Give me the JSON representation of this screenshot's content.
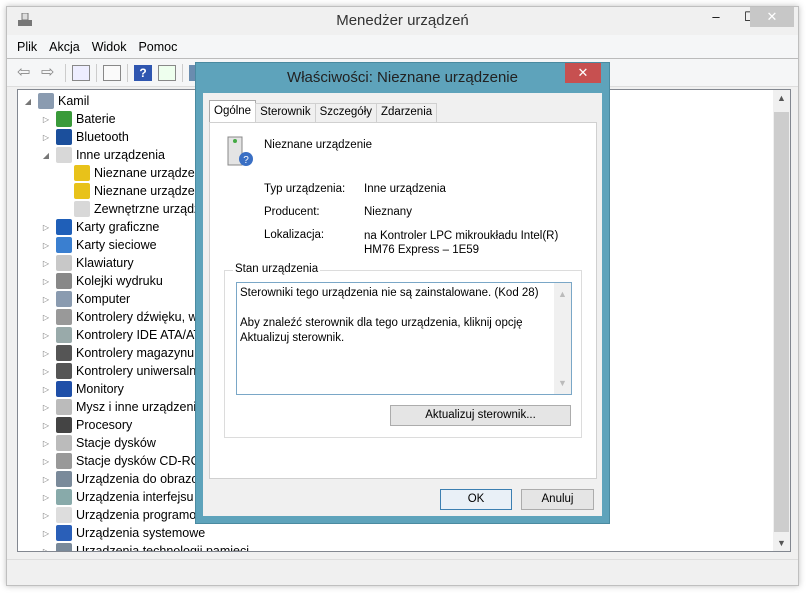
{
  "window": {
    "title": "Menedżer urządzeń",
    "minimize": "–",
    "maximize": "☐",
    "close": "✕"
  },
  "menu": [
    "Plik",
    "Akcja",
    "Widok",
    "Pomoc"
  ],
  "toolbar_icons": [
    "back-icon",
    "forward-icon",
    "properties-pane-icon",
    "console-icon",
    "help-icon",
    "action-pane-icon",
    "scan-hardware-icon"
  ],
  "tree": [
    {
      "label": "Kamil",
      "level": 0,
      "expanded": true,
      "icon": "computer-icon"
    },
    {
      "label": "Baterie",
      "level": 1,
      "expanded": false,
      "icon": "battery-icon"
    },
    {
      "label": "Bluetooth",
      "level": 1,
      "expanded": false,
      "icon": "bluetooth-icon"
    },
    {
      "label": "Inne urządzenia",
      "level": 1,
      "expanded": true,
      "icon": "unknown-device-icon"
    },
    {
      "label": "Nieznane urządzen",
      "level": 2,
      "icon": "warning-device-icon"
    },
    {
      "label": "Nieznane urządzen",
      "level": 2,
      "icon": "warning-device-icon"
    },
    {
      "label": "Zewnętrzne urządz",
      "level": 2,
      "icon": "unknown-device-icon"
    },
    {
      "label": "Karty graficzne",
      "level": 1,
      "expanded": false,
      "icon": "display-adapter-icon"
    },
    {
      "label": "Karty sieciowe",
      "level": 1,
      "expanded": false,
      "icon": "network-adapter-icon"
    },
    {
      "label": "Klawiatury",
      "level": 1,
      "expanded": false,
      "icon": "keyboard-icon"
    },
    {
      "label": "Kolejki wydruku",
      "level": 1,
      "expanded": false,
      "icon": "printer-icon"
    },
    {
      "label": "Komputer",
      "level": 1,
      "expanded": false,
      "icon": "computer-icon"
    },
    {
      "label": "Kontrolery dźwięku, wi",
      "level": 1,
      "expanded": false,
      "icon": "speaker-icon"
    },
    {
      "label": "Kontrolery IDE ATA/AT",
      "level": 1,
      "expanded": false,
      "icon": "ide-icon"
    },
    {
      "label": "Kontrolery magazynu",
      "level": 1,
      "expanded": false,
      "icon": "storage-icon"
    },
    {
      "label": "Kontrolery uniwersalne",
      "level": 1,
      "expanded": false,
      "icon": "usb-icon"
    },
    {
      "label": "Monitory",
      "level": 1,
      "expanded": false,
      "icon": "monitor-icon"
    },
    {
      "label": "Mysz i inne urządzenia",
      "level": 1,
      "expanded": false,
      "icon": "mouse-icon"
    },
    {
      "label": "Procesory",
      "level": 1,
      "expanded": false,
      "icon": "processor-icon"
    },
    {
      "label": "Stacje dysków",
      "level": 1,
      "expanded": false,
      "icon": "disk-icon"
    },
    {
      "label": "Stacje dysków CD-ROM",
      "level": 1,
      "expanded": false,
      "icon": "cdrom-icon"
    },
    {
      "label": "Urządzenia do obrazow",
      "level": 1,
      "expanded": false,
      "icon": "camera-icon"
    },
    {
      "label": "Urządzenia interfejsu H",
      "level": 1,
      "expanded": false,
      "icon": "hid-icon"
    },
    {
      "label": "Urządzenia programow",
      "level": 1,
      "expanded": false,
      "icon": "software-device-icon"
    },
    {
      "label": "Urządzenia systemowe",
      "level": 1,
      "expanded": false,
      "icon": "system-icon"
    },
    {
      "label": "Urządzenia technologii pamięci",
      "level": 1,
      "expanded": false,
      "icon": "memory-icon"
    }
  ],
  "dialog": {
    "title": "Właściwości: Nieznane urządzenie",
    "close": "✕",
    "tabs": [
      "Ogólne",
      "Sterownik",
      "Szczegóły",
      "Zdarzenia"
    ],
    "device_name": "Nieznane urządzenie",
    "fields": [
      {
        "label": "Typ urządzenia:",
        "value": "Inne urządzenia"
      },
      {
        "label": "Producent:",
        "value": "Nieznany"
      },
      {
        "label": "Lokalizacja:",
        "value": "na Kontroler LPC mikroukładu Intel(R) HM76 Express – 1E59"
      }
    ],
    "status_group": "Stan urządzenia",
    "status_line1": "Sterowniki tego urządzenia nie są zainstalowane. (Kod 28)",
    "status_line2": "Aby znaleźć sterownik dla tego urządzenia, kliknij opcję Aktualizuj sterownik.",
    "update_button": "Aktualizuj sterownik...",
    "ok": "OK",
    "cancel": "Anuluj"
  },
  "colors": {
    "dialog_frame": "#5ea3bb",
    "close_red": "#c75050"
  }
}
